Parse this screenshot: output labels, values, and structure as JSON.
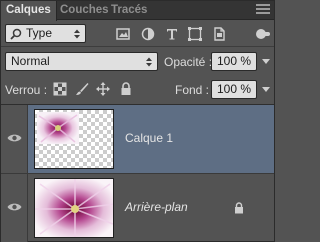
{
  "tabs": [
    {
      "label": "Calques",
      "active": true
    },
    {
      "label": "Couches",
      "active": false
    },
    {
      "label": "Tracés",
      "active": false
    }
  ],
  "filter": {
    "kind_value": "Type",
    "icons": [
      "image-filter-icon",
      "adjustment-filter-icon",
      "text-filter-icon",
      "shape-filter-icon",
      "smart-object-filter-icon"
    ]
  },
  "blend": {
    "mode_value": "Normal",
    "opacity_label": "Opacité :",
    "opacity_value": "100 %"
  },
  "lock": {
    "label": "Verrou :",
    "icons": [
      "lock-transparent-pixels-icon",
      "lock-image-pixels-icon",
      "lock-position-icon",
      "lock-all-icon"
    ],
    "fill_label": "Fond :",
    "fill_value": "100 %"
  },
  "layers": [
    {
      "name": "Calque 1",
      "selected": true,
      "visible": true,
      "locked": false
    },
    {
      "name": "Arrière-plan",
      "selected": false,
      "visible": true,
      "locked": true
    }
  ],
  "colors": {
    "panel_bg": "#535353",
    "selected_row": "#5e6e84",
    "tab_bar": "#343434"
  }
}
